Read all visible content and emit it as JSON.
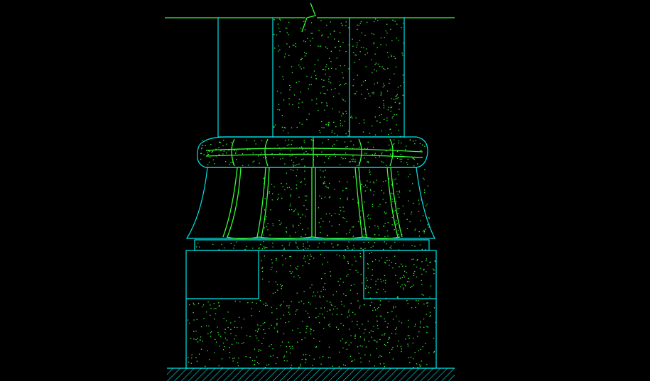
{
  "drawing": {
    "background": "#000000",
    "colors": {
      "outline": "#00e5e5",
      "molding": "#33ff33",
      "hatch": "#00e5e5",
      "stipple": "#33ff33"
    },
    "components": [
      "top-line",
      "break-symbol",
      "column-shaft",
      "torus-ring",
      "fluted-capital",
      "plinth",
      "stepped-pedestal",
      "ground-hatch"
    ]
  }
}
